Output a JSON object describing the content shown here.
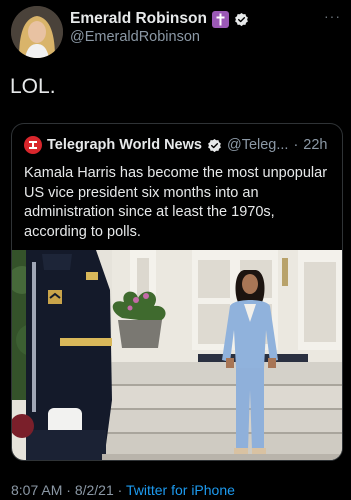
{
  "author": {
    "name": "Emerald Robinson",
    "handle": "@EmeraldRobinson"
  },
  "tweet": {
    "text": "LOL."
  },
  "quoted": {
    "name": "Telegraph World News",
    "handle": "@Teleg...",
    "separator": "·",
    "time": "22h",
    "text": "Kamala Harris has become the most unpopular US vice president six months into an administration since at least the 1970s, according to polls."
  },
  "footer": {
    "time": "8:07 AM",
    "sep1": " · ",
    "date": "8/2/21",
    "sep2": " · ",
    "source": "Twitter for iPhone"
  },
  "colors": {
    "link": "#1d9bf0",
    "verified": "#e7e9ea",
    "badge": "#9b59b6",
    "telegraph": "#d9262c"
  }
}
